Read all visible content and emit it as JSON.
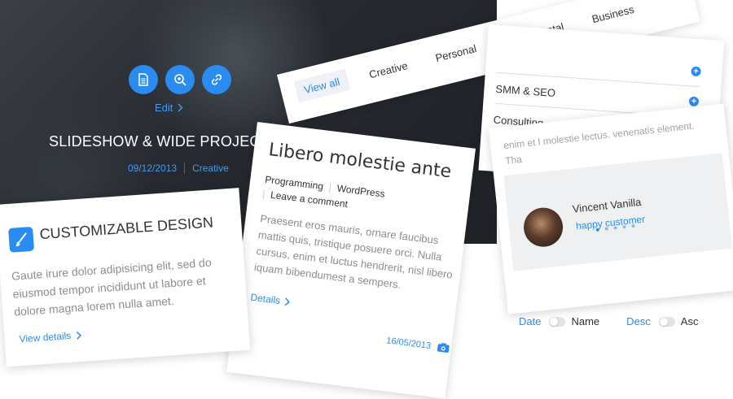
{
  "hero": {
    "edit_label": "Edit",
    "title": "SLIDESHOW & WIDE PROJECT",
    "date": "09/12/2013",
    "category": "Creative",
    "icons": [
      "document-icon",
      "zoom-icon",
      "link-icon"
    ]
  },
  "feature": {
    "title": "CUSTOMIZABLE DESIGN",
    "text": "Gaute irure dolor adipisicing elit, sed do eiusmod tempor incididunt ut labore et dolore magna lorem nulla amet.",
    "link": "View details",
    "icon": "brush-icon"
  },
  "post": {
    "title": "Libero molestie ante",
    "categories": [
      "Programming",
      "WordPress"
    ],
    "comment": "Leave a comment",
    "text": "Praesent eros mauris, ornare faucibus mattis quis, tristique posuere orci. Nulla cursus, enim et luctus hendrerit, nisl libero iquam bibendumest a sempers.",
    "link": "Details",
    "date": "16/05/2013",
    "icon": "camera-icon"
  },
  "filter": {
    "items": [
      "View all",
      "Creative",
      "Personal",
      "Experimental",
      "Business"
    ]
  },
  "services": {
    "items": [
      "SMM & SEO",
      "Consulting"
    ]
  },
  "testimonial": {
    "text": "enim et l molestie lectus. venenatis element. Tha",
    "name": "Vincent Vanilla",
    "role": "happy customer"
  },
  "sort": {
    "date": "Date",
    "name": "Name",
    "desc": "Desc",
    "asc": "Asc"
  },
  "colors": {
    "accent": "#2a8cf0",
    "hero_bg": "#2a2e34"
  }
}
